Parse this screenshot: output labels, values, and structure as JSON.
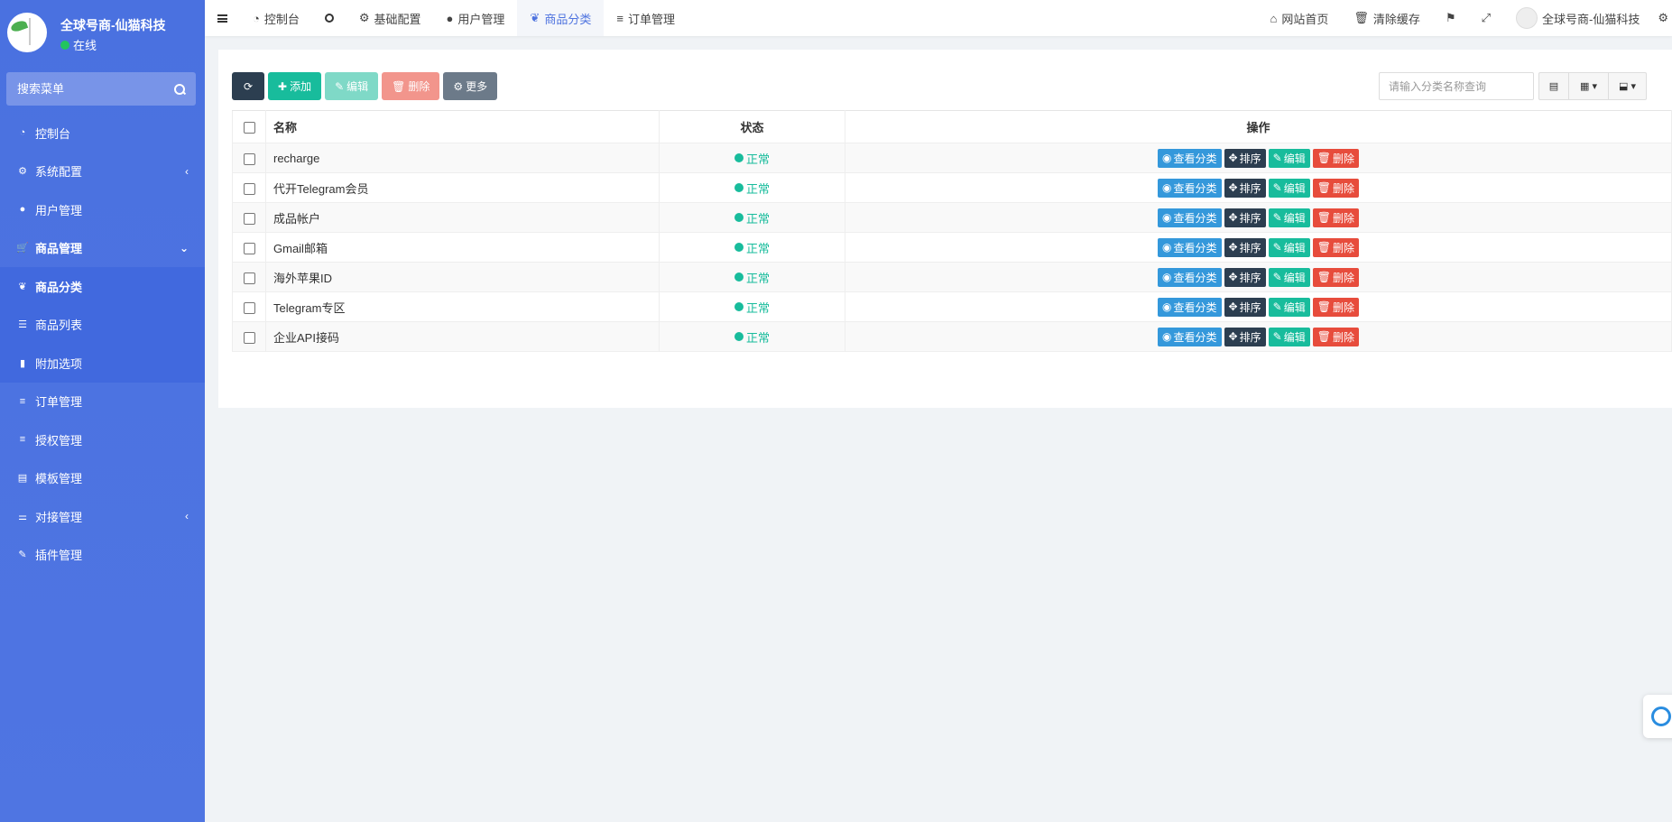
{
  "sidebar": {
    "user_name": "全球号商-仙猫科技",
    "user_status": "在线",
    "search_placeholder": "搜索菜单",
    "items": [
      {
        "label": "控制台",
        "icon": "dashboard-icon"
      },
      {
        "label": "系统配置",
        "icon": "gear-icon",
        "caret": "‹"
      },
      {
        "label": "用户管理",
        "icon": "user-icon"
      },
      {
        "label": "商品管理",
        "icon": "cart-icon",
        "caret": "⌄"
      },
      {
        "label": "商品分类",
        "icon": "leaf-icon"
      },
      {
        "label": "商品列表",
        "icon": "list-icon"
      },
      {
        "label": "附加选项",
        "icon": "bookmark-icon"
      },
      {
        "label": "订单管理",
        "icon": "bars-icon"
      },
      {
        "label": "授权管理",
        "icon": "bars-icon"
      },
      {
        "label": "模板管理",
        "icon": "keyboard-icon"
      },
      {
        "label": "对接管理",
        "icon": "sliders-icon",
        "caret": "‹"
      },
      {
        "label": "插件管理",
        "icon": "wrench-icon"
      }
    ]
  },
  "topbar": {
    "tabs": [
      {
        "label": "控制台",
        "icon": "dashboard-icon"
      },
      {
        "label": "",
        "icon": "circle-icon"
      },
      {
        "label": "基础配置",
        "icon": "gear-icon"
      },
      {
        "label": "用户管理",
        "icon": "user-icon"
      },
      {
        "label": "商品分类",
        "icon": "leaf-icon",
        "active": true
      },
      {
        "label": "订单管理",
        "icon": "bars-icon"
      }
    ],
    "right": {
      "home": "网站首页",
      "clear_cache": "清除缓存",
      "user": "全球号商-仙猫科技"
    }
  },
  "toolbar": {
    "add": "添加",
    "edit": "编辑",
    "delete": "删除",
    "more": "更多",
    "search_placeholder": "请输入分类名称查询"
  },
  "table": {
    "headers": {
      "name": "名称",
      "status": "状态",
      "ops": "操作"
    },
    "rows": [
      {
        "name": "recharge",
        "status": "正常"
      },
      {
        "name": "代开Telegram会员",
        "status": "正常"
      },
      {
        "name": "成品帐户",
        "status": "正常"
      },
      {
        "name": "Gmail邮箱",
        "status": "正常"
      },
      {
        "name": "海外苹果ID",
        "status": "正常"
      },
      {
        "name": "Telegram专区",
        "status": "正常"
      },
      {
        "name": "企业API接码",
        "status": "正常"
      }
    ],
    "row_actions": {
      "view": "查看分类",
      "sort": "排序",
      "edit": "编辑",
      "delete": "删除"
    }
  },
  "colors": {
    "sidebar": "#4e73df",
    "success": "#18bc9c",
    "primary": "#3498db",
    "danger": "#e74c3c",
    "dark": "#2c3e50"
  }
}
